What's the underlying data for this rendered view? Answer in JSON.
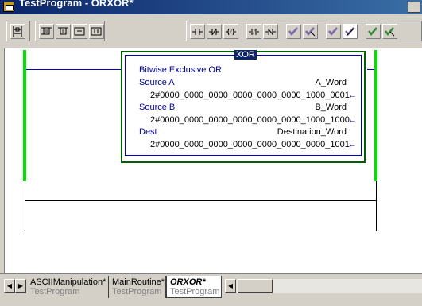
{
  "window": {
    "title": "TestProgram - ORXOR*"
  },
  "instruction": {
    "mnemonic": "XOR",
    "description": "Bitwise Exclusive OR",
    "operands": [
      {
        "label": "Source A",
        "tag": "A_Word",
        "value": "2#0000_0000_0000_0000_0000_0000_1000_0001"
      },
      {
        "label": "Source B",
        "tag": "B_Word",
        "value": "2#0000_0000_0000_0000_0000_0000_1000_1000"
      },
      {
        "label": "Dest",
        "tag": "Destination_Word",
        "value": "2#0000_0000_0000_0000_0000_0000_0000_1001"
      }
    ],
    "arrow": "←"
  },
  "tabs": [
    {
      "name": "ASCIIManipulation*",
      "program": "TestProgram"
    },
    {
      "name": "MainRoutine*",
      "program": "TestProgram"
    },
    {
      "name": "ORXOR*",
      "program": "TestProgram"
    }
  ],
  "colors": {
    "rail": "#00e000",
    "accent": "#0000c0",
    "box_border": "#006000"
  }
}
